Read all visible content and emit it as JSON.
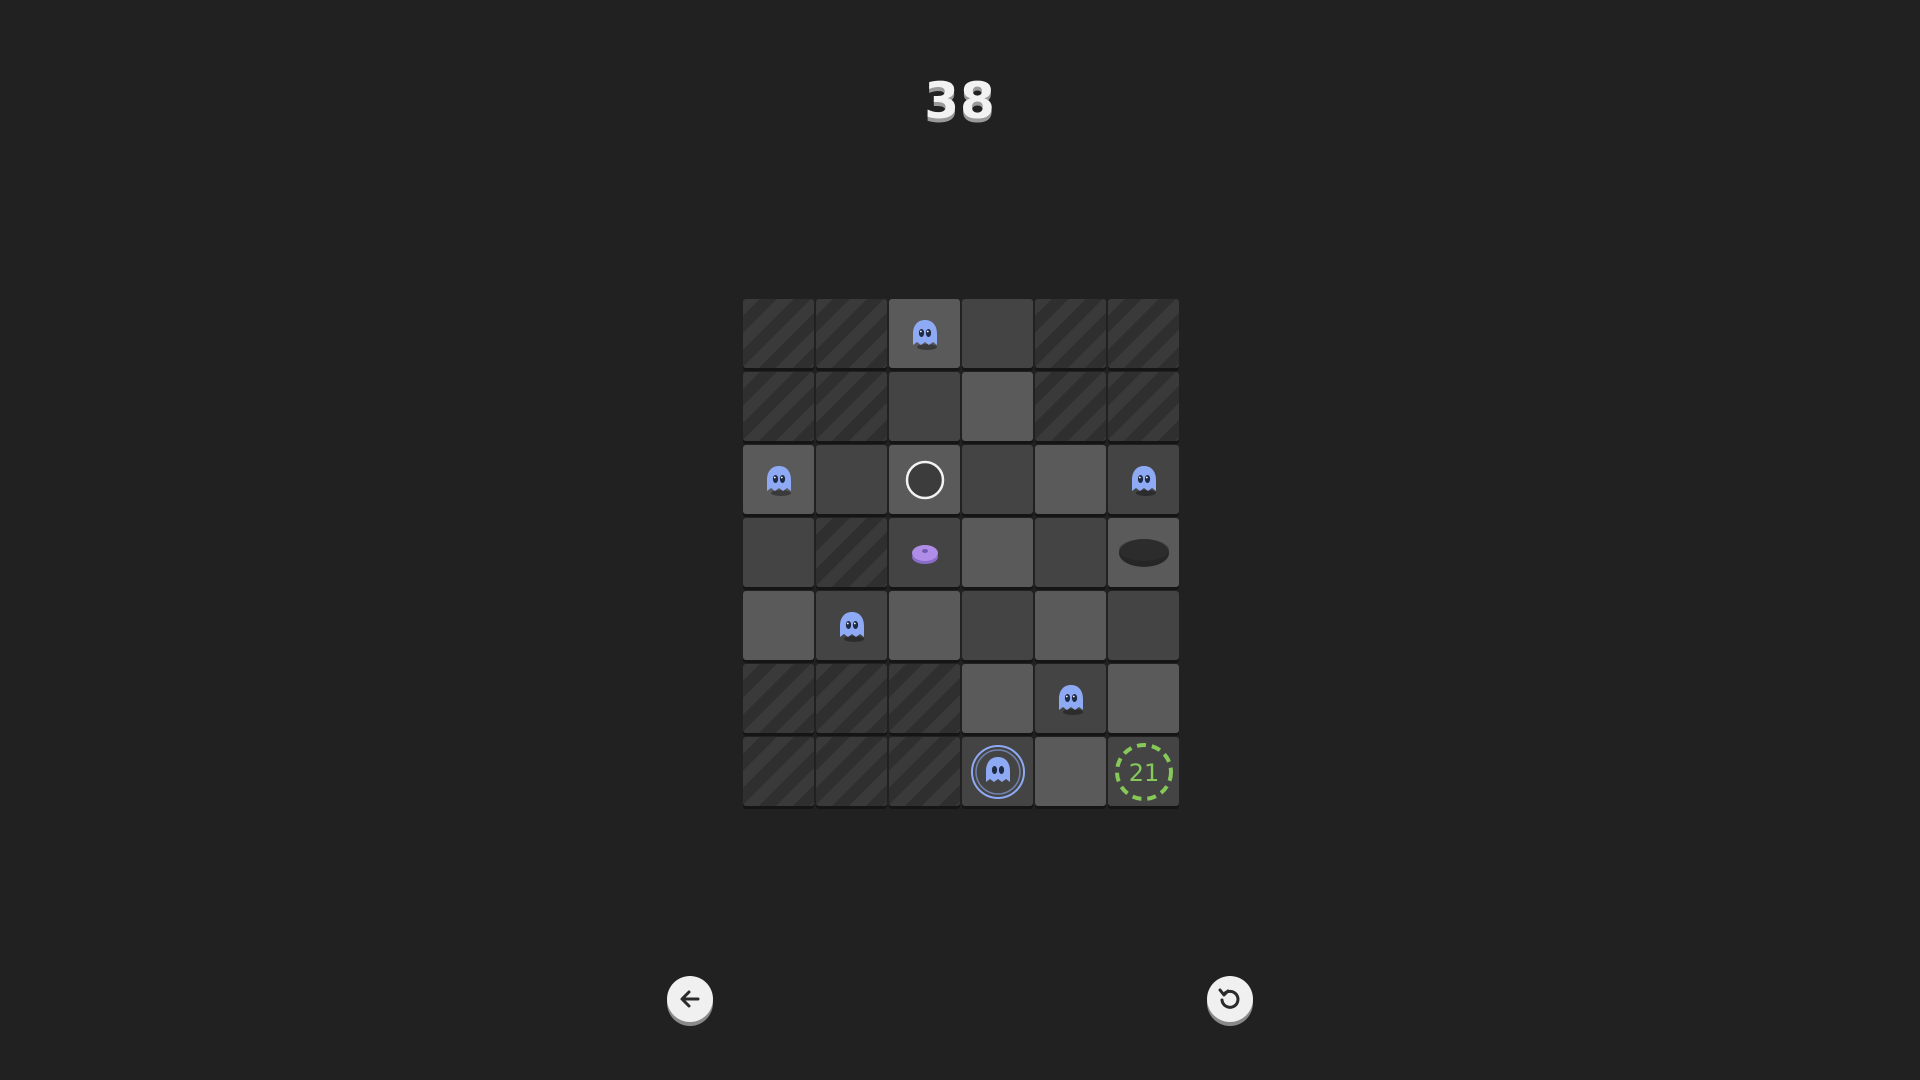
{
  "level": "38",
  "colors": {
    "background": "#212121",
    "tile_light": "#5a5a5a",
    "tile_dark": "#444444",
    "ghost": "#8faaf5",
    "coin": "#b08ee8",
    "goal": "#86c958"
  },
  "board": {
    "rows": 7,
    "cols": 6,
    "cells": [
      [
        "hatch",
        "hatch",
        "light",
        "dark",
        "hatch",
        "hatch"
      ],
      [
        "hatch",
        "hatch",
        "dark",
        "light",
        "hatch",
        "hatch"
      ],
      [
        "light",
        "dark",
        "light",
        "dark",
        "light",
        "dark"
      ],
      [
        "dark",
        "hatch",
        "dark",
        "light",
        "dark",
        "light"
      ],
      [
        "light",
        "dark",
        "light",
        "dark",
        "light",
        "dark"
      ],
      [
        "hatch",
        "hatch",
        "hatch",
        "light",
        "dark",
        "light"
      ],
      [
        "hatch",
        "hatch",
        "hatch",
        "dark",
        "light",
        "dark"
      ]
    ],
    "pieces": [
      {
        "type": "ghost",
        "row": 0,
        "col": 2
      },
      {
        "type": "ghost",
        "row": 2,
        "col": 0
      },
      {
        "type": "ring",
        "row": 2,
        "col": 2
      },
      {
        "type": "ghost",
        "row": 2,
        "col": 5
      },
      {
        "type": "coin",
        "row": 3,
        "col": 2
      },
      {
        "type": "hole",
        "row": 3,
        "col": 5
      },
      {
        "type": "ghost",
        "row": 4,
        "col": 1
      },
      {
        "type": "ghost",
        "row": 5,
        "col": 4
      },
      {
        "type": "player-ghost",
        "row": 6,
        "col": 3
      },
      {
        "type": "goal",
        "row": 6,
        "col": 5,
        "label": "21"
      }
    ]
  },
  "controls": {
    "back_icon": "arrow-left-icon",
    "restart_icon": "restart-icon"
  }
}
